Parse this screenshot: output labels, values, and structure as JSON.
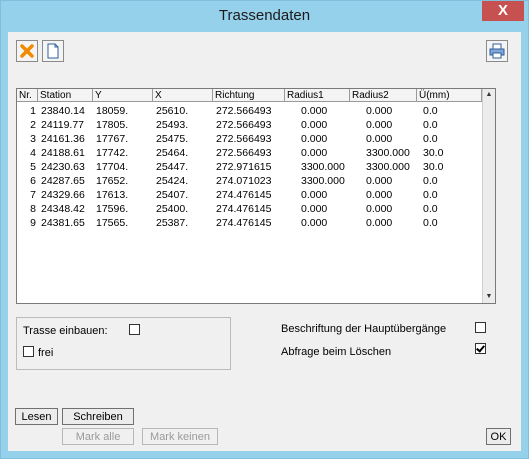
{
  "window": {
    "title": "Trassendaten",
    "close_glyph": "X"
  },
  "toolbar": {
    "delete_icon": "delete-x-icon",
    "new_icon": "new-document-icon",
    "print_icon": "printer-icon"
  },
  "table": {
    "headers": [
      "Nr.",
      "Station",
      "Y",
      "X",
      "Richtung",
      "Radius1",
      "Radius2",
      "Ü(mm)"
    ],
    "rows": [
      [
        "1",
        "23840.14",
        "18059.",
        "25610.",
        "272.566493",
        "0.000",
        "0.000",
        "0.0"
      ],
      [
        "2",
        "24119.77",
        "17805.",
        "25493.",
        "272.566493",
        "0.000",
        "0.000",
        "0.0"
      ],
      [
        "3",
        "24161.36",
        "17767.",
        "25475.",
        "272.566493",
        "0.000",
        "0.000",
        "0.0"
      ],
      [
        "4",
        "24188.61",
        "17742.",
        "25464.",
        "272.566493",
        "0.000",
        "3300.000",
        "30.0"
      ],
      [
        "5",
        "24230.63",
        "17704.",
        "25447.",
        "272.971615",
        "3300.000",
        "3300.000",
        "30.0"
      ],
      [
        "6",
        "24287.65",
        "17652.",
        "25424.",
        "274.071023",
        "3300.000",
        "0.000",
        "0.0"
      ],
      [
        "7",
        "24329.66",
        "17613.",
        "25407.",
        "274.476145",
        "0.000",
        "0.000",
        "0.0"
      ],
      [
        "8",
        "24348.42",
        "17596.",
        "25400.",
        "274.476145",
        "0.000",
        "0.000",
        "0.0"
      ],
      [
        "9",
        "24381.65",
        "17565.",
        "25387.",
        "274.476145",
        "0.000",
        "0.000",
        "0.0"
      ]
    ]
  },
  "options": {
    "trasse_einbauen": {
      "label": "Trasse einbauen:",
      "checked": false
    },
    "frei": {
      "label": "frei",
      "checked": false
    },
    "beschriftung": {
      "label": "Beschriftung der Hauptübergänge",
      "checked": false
    },
    "abfrage": {
      "label": "Abfrage beim Löschen",
      "checked": true
    }
  },
  "buttons": {
    "lesen": "Lesen",
    "schreiben": "Schreiben",
    "mark_alle": "Mark alle",
    "mark_keinen": "Mark keinen",
    "ok": "OK"
  }
}
